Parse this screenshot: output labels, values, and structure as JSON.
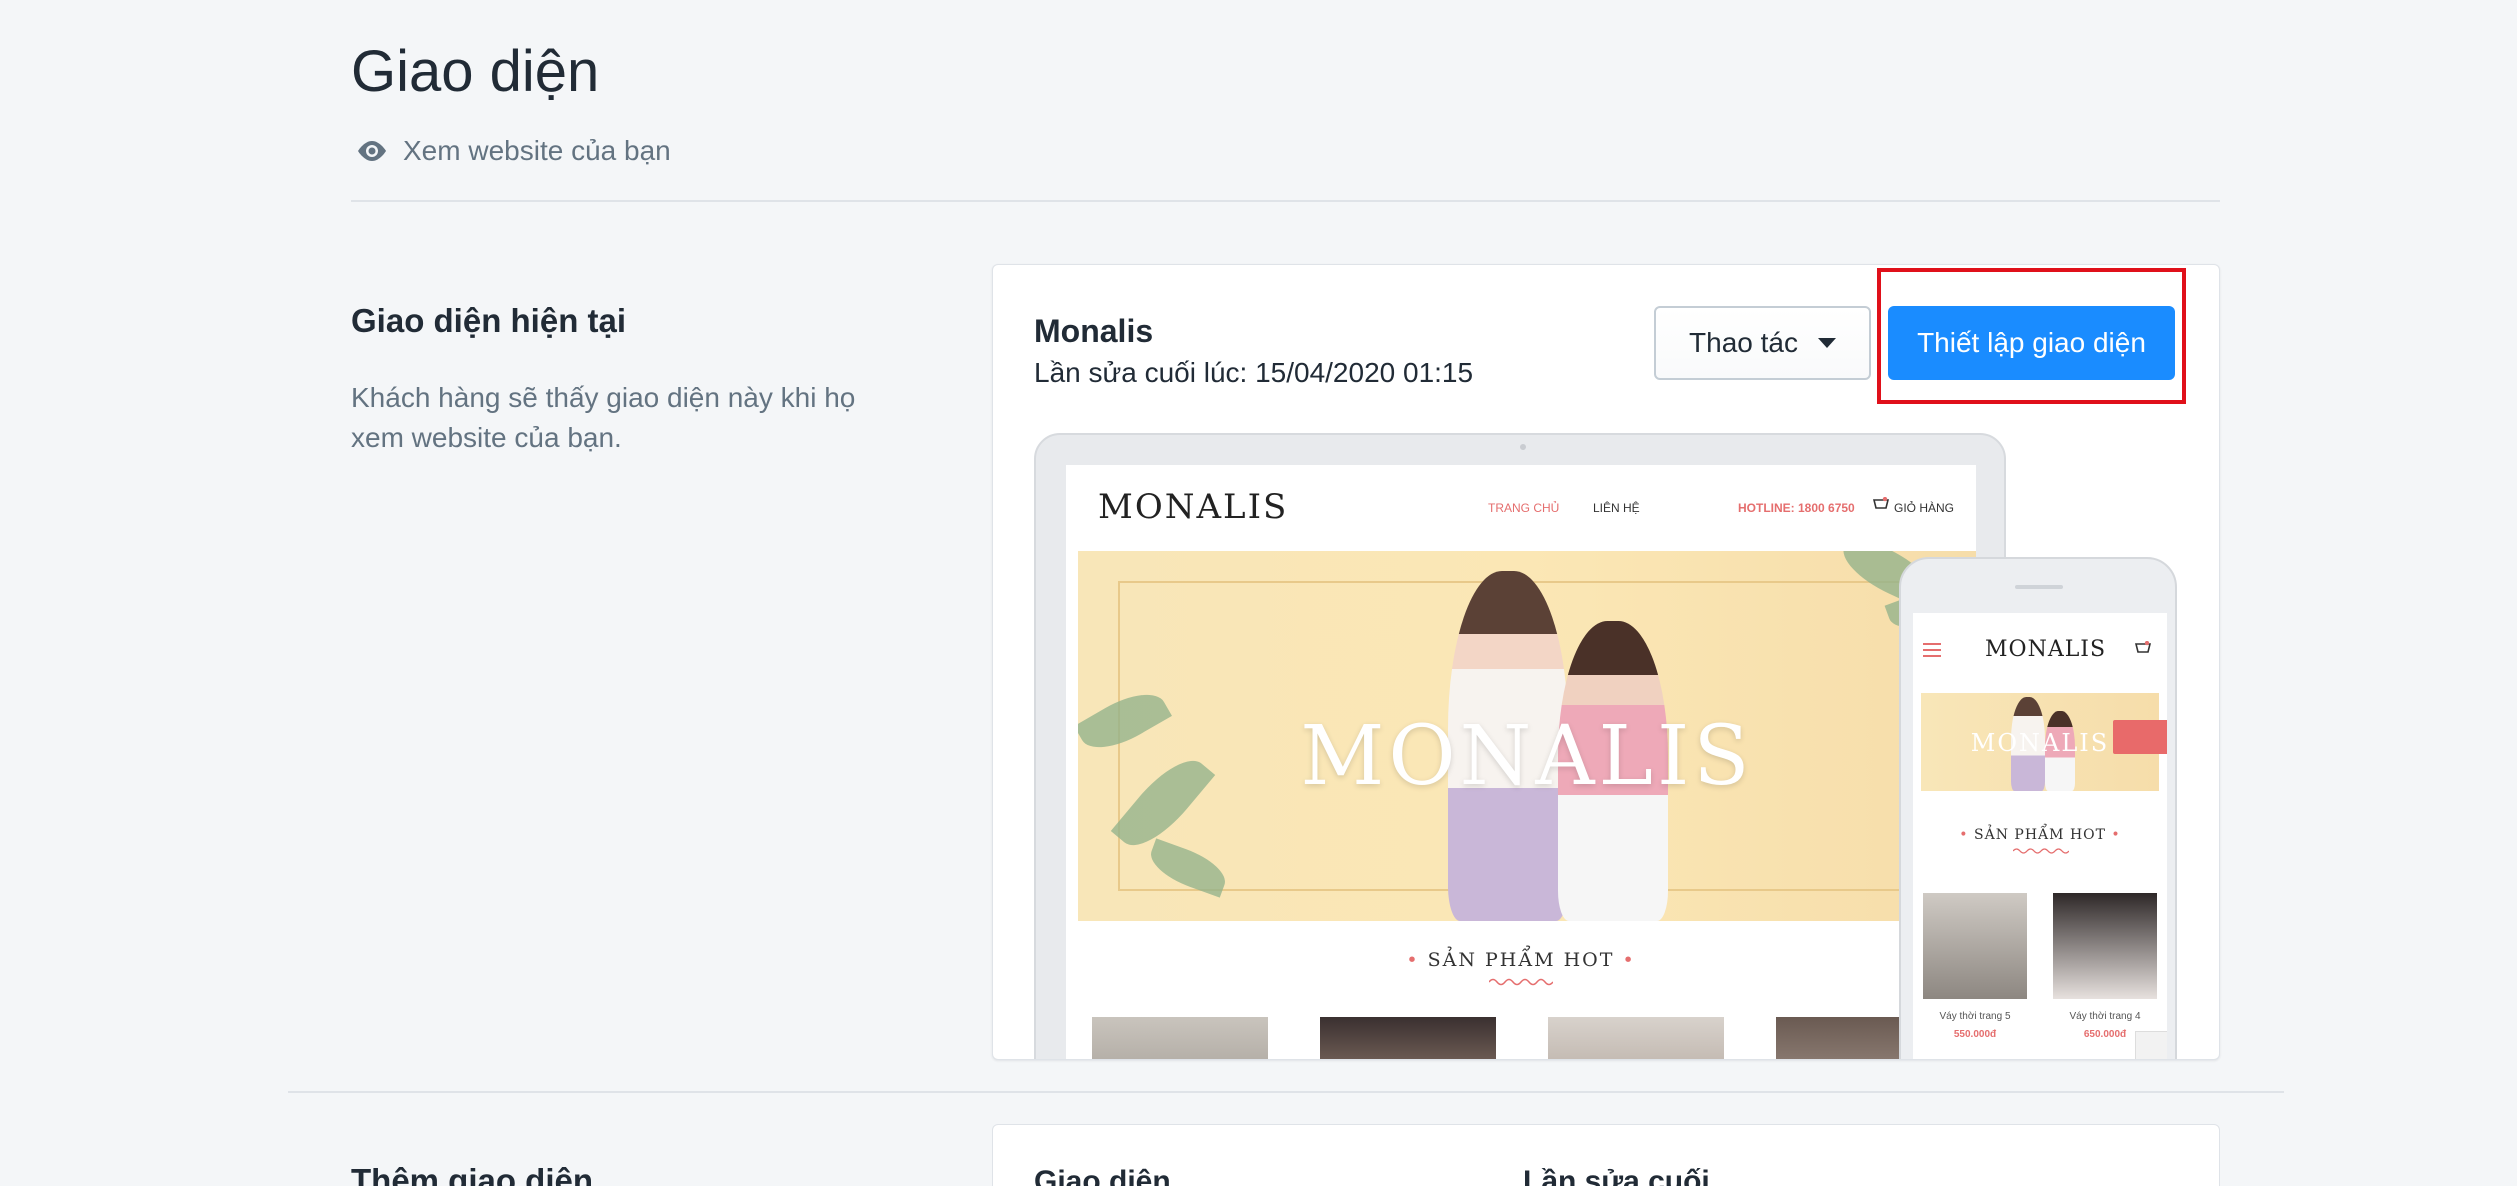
{
  "page": {
    "title": "Giao diện",
    "view_site_label": "Xem website của bạn"
  },
  "current_theme_section": {
    "title": "Giao diện hiện tại",
    "description": "Khách hàng sẽ thấy giao diện này khi họ xem website của bạn."
  },
  "theme_card": {
    "name": "Monalis",
    "last_edited": "Lần sửa cuối lúc: 15/04/2020 01:15",
    "actions_label": "Thao tác",
    "customize_label": "Thiết lập giao diện"
  },
  "preview": {
    "logo": "MONALIS",
    "nav_home": "TRANG CHỦ",
    "nav_contact": "LIÊN HỆ",
    "hotline": "HOTLINE: 1800 6750",
    "cart": "GIỎ HÀNG",
    "banner_text": "MONALIS",
    "hot_section": "SẢN PHẨM HOT",
    "mobile_products": [
      {
        "name": "Váy thời trang 5",
        "price": "550.000đ"
      },
      {
        "name": "Váy thời trang 4",
        "price": "650.000đ"
      }
    ]
  },
  "add_theme_section": {
    "title": "Thêm giao diện",
    "col_theme": "Giao diện",
    "col_last_edit": "Lần sửa cuối"
  },
  "colors": {
    "primary": "#1a8cff",
    "highlight": "#e0101a",
    "accent_pink": "#e56e6e"
  },
  "icons": {
    "view": "eye-icon",
    "dropdown": "caret-down-icon",
    "cart": "cart-icon",
    "menu": "hamburger-icon"
  }
}
